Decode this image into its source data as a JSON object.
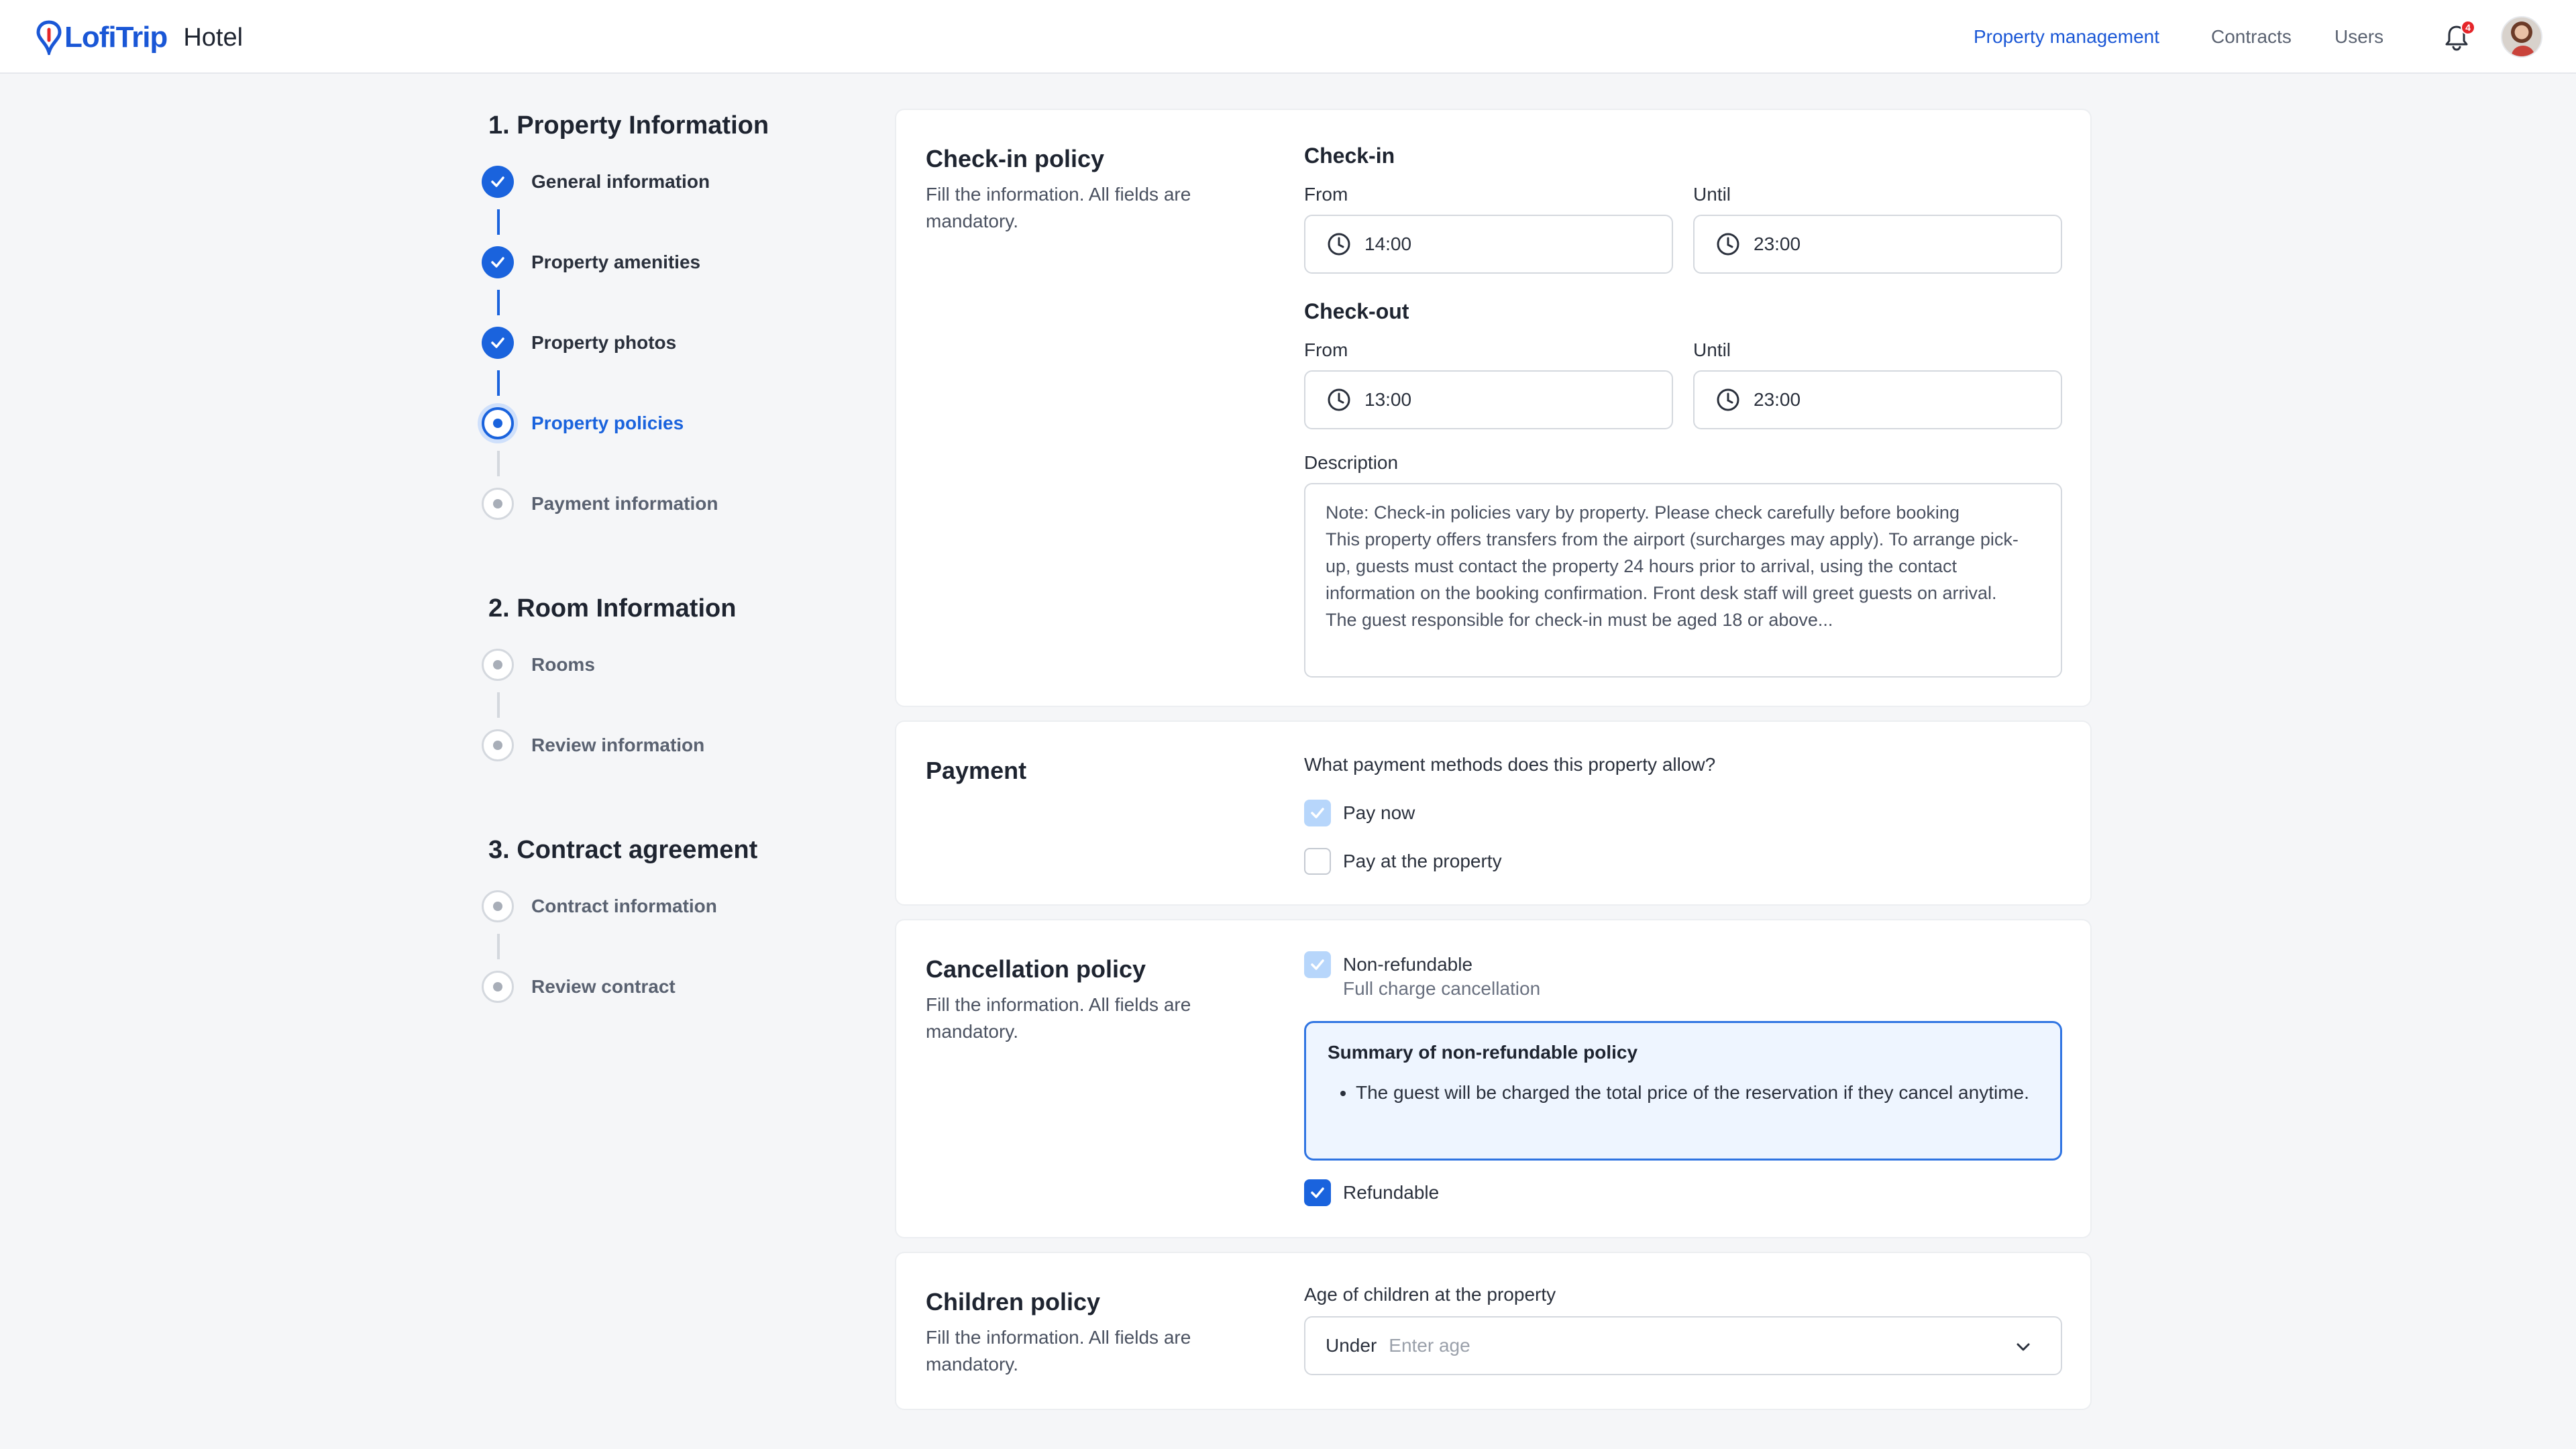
{
  "header": {
    "brand": "LofiTrip",
    "product": "Hotel",
    "nav": {
      "property_management": "Property management",
      "contracts": "Contracts",
      "users": "Users"
    },
    "notification_count": "4",
    "icons": {
      "bell": "bell-icon",
      "avatar": "user-avatar"
    },
    "colors": {
      "brand": "#1a57d6",
      "badge": "#e5252a"
    }
  },
  "stepper": {
    "sections": [
      {
        "title": "1. Property Information",
        "steps": [
          {
            "label": "General information",
            "status": "done"
          },
          {
            "label": "Property amenities",
            "status": "done"
          },
          {
            "label": "Property photos",
            "status": "done"
          },
          {
            "label": "Property policies",
            "status": "active"
          },
          {
            "label": "Payment information",
            "status": "todo"
          }
        ]
      },
      {
        "title": "2. Room Information",
        "steps": [
          {
            "label": "Rooms",
            "status": "todo"
          },
          {
            "label": "Review information",
            "status": "todo"
          }
        ]
      },
      {
        "title": "3. Contract agreement",
        "steps": [
          {
            "label": "Contract information",
            "status": "todo"
          },
          {
            "label": "Review contract",
            "status": "todo"
          }
        ]
      }
    ]
  },
  "checkin_card": {
    "title": "Check-in policy",
    "subtitle": "Fill the information. All fields are mandatory.",
    "checkin": {
      "heading": "Check-in",
      "from_label": "From",
      "from_value": "14:00",
      "until_label": "Until",
      "until_value": "23:00"
    },
    "checkout": {
      "heading": "Check-out",
      "from_label": "From",
      "from_value": "13:00",
      "until_label": "Until",
      "until_value": "23:00"
    },
    "description_label": "Description",
    "description_lines": [
      "Note: Check-in policies vary by property. Please check carefully before booking",
      "This property offers transfers from the airport (surcharges may apply). To arrange pick-up, guests must contact the property 24 hours prior to arrival, using the contact information on the booking confirmation. Front desk staff will greet guests on arrival.",
      "The guest responsible for check-in must be aged 18 or above..."
    ]
  },
  "payment_card": {
    "title": "Payment",
    "question": "What payment methods does this property allow?",
    "options": [
      {
        "label": "Pay now",
        "checked": true
      },
      {
        "label": "Pay at the property",
        "checked": false
      }
    ]
  },
  "cancellation_card": {
    "title": "Cancellation policy",
    "subtitle": "Fill the information. All fields are mandatory.",
    "non_refundable": {
      "label": "Non-refundable",
      "hint": "Full charge cancellation",
      "checked": true
    },
    "summary": {
      "title": "Summary of non-refundable policy",
      "items": [
        "The guest will be charged the total price of the reservation if they cancel anytime."
      ]
    },
    "refundable": {
      "label": "Refundable",
      "checked": true
    }
  },
  "children_card": {
    "title": "Children policy",
    "subtitle": "Fill the information. All fields are mandatory.",
    "age_label": "Age of children at the property",
    "select_prefix": "Under",
    "select_placeholder": "Enter age"
  }
}
